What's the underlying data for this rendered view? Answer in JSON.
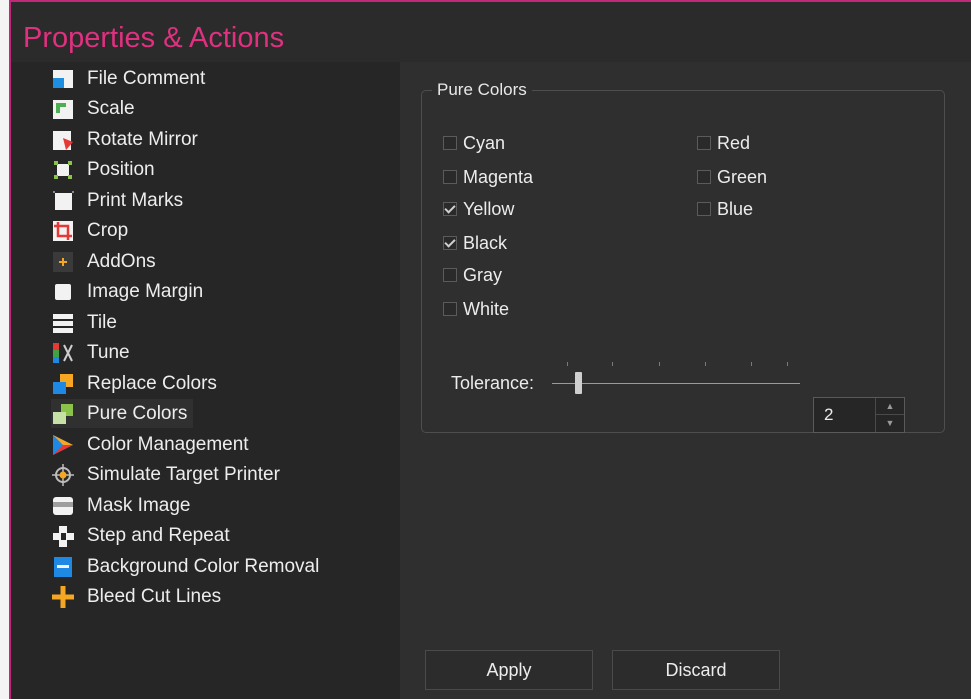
{
  "window": {
    "title": "Properties & Actions"
  },
  "nav": {
    "selected": "Pure Colors",
    "items": [
      {
        "label": "File Comment",
        "icon": "file-comment-icon"
      },
      {
        "label": "Scale",
        "icon": "scale-icon"
      },
      {
        "label": "Rotate Mirror",
        "icon": "rotate-mirror-icon"
      },
      {
        "label": "Position",
        "icon": "position-icon"
      },
      {
        "label": "Print Marks",
        "icon": "print-marks-icon"
      },
      {
        "label": "Crop",
        "icon": "crop-icon"
      },
      {
        "label": "AddOns",
        "icon": "addons-icon"
      },
      {
        "label": "Image Margin",
        "icon": "image-margin-icon"
      },
      {
        "label": "Tile",
        "icon": "tile-icon"
      },
      {
        "label": "Tune",
        "icon": "tune-icon"
      },
      {
        "label": "Replace Colors",
        "icon": "replace-colors-icon"
      },
      {
        "label": "Pure Colors",
        "icon": "pure-colors-icon"
      },
      {
        "label": "Color Management",
        "icon": "color-management-icon"
      },
      {
        "label": "Simulate Target Printer",
        "icon": "simulate-target-printer-icon"
      },
      {
        "label": "Mask Image",
        "icon": "mask-image-icon"
      },
      {
        "label": "Step and Repeat",
        "icon": "step-and-repeat-icon"
      },
      {
        "label": "Background Color Removal",
        "icon": "background-color-removal-icon"
      },
      {
        "label": "Bleed Cut Lines",
        "icon": "bleed-cut-lines-icon"
      }
    ]
  },
  "pure_colors": {
    "group_title": "Pure Colors",
    "checkboxes": [
      {
        "label": "Cyan",
        "checked": false
      },
      {
        "label": "Magenta",
        "checked": false
      },
      {
        "label": "Yellow",
        "checked": true
      },
      {
        "label": "Black",
        "checked": true
      },
      {
        "label": "Gray",
        "checked": false
      },
      {
        "label": "White",
        "checked": false
      },
      {
        "label": "Red",
        "checked": false
      },
      {
        "label": "Green",
        "checked": false
      },
      {
        "label": "Blue",
        "checked": false
      }
    ],
    "tolerance": {
      "label": "Tolerance:",
      "value": "2"
    }
  },
  "buttons": {
    "apply": "Apply",
    "discard": "Discard"
  },
  "colors": {
    "accent": "#e0307f",
    "border": "#c2287a"
  }
}
